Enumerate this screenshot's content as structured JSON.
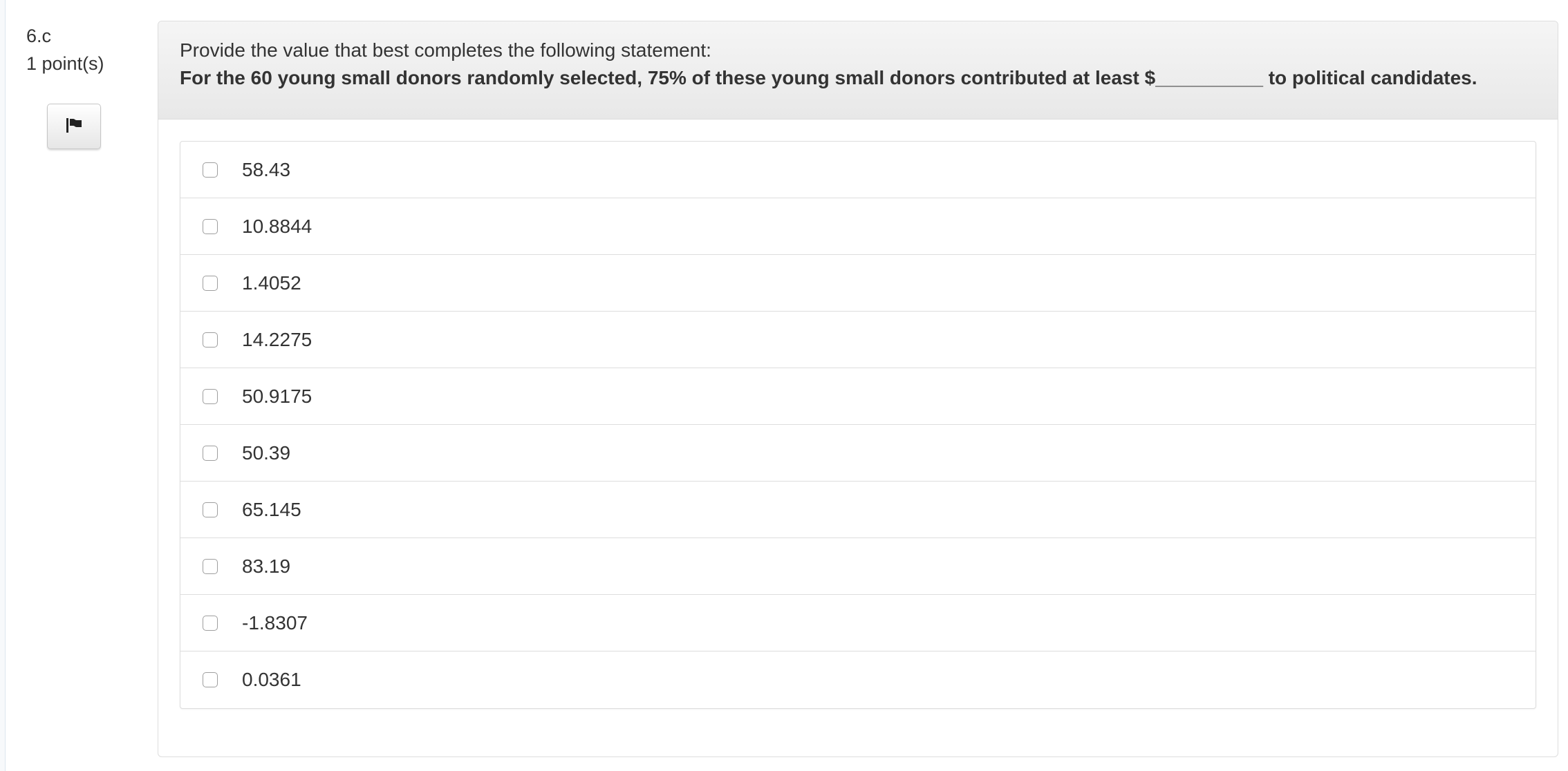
{
  "question": {
    "number": "6.c",
    "points": "1 point(s)",
    "flag_icon": "flag-icon",
    "prompt": "Provide the value that best completes the following statement:",
    "statement": "For the 60 young small donors randomly selected, 75% of these young small donors contributed at least $__________ to political candidates."
  },
  "options": [
    {
      "label": "58.43",
      "checked": false
    },
    {
      "label": "10.8844",
      "checked": false
    },
    {
      "label": "1.4052",
      "checked": false
    },
    {
      "label": "14.2275",
      "checked": false
    },
    {
      "label": "50.9175",
      "checked": false
    },
    {
      "label": "50.39",
      "checked": false
    },
    {
      "label": "65.145",
      "checked": false
    },
    {
      "label": "83.19",
      "checked": false
    },
    {
      "label": "-1.8307",
      "checked": false
    },
    {
      "label": "0.0361",
      "checked": false
    }
  ]
}
